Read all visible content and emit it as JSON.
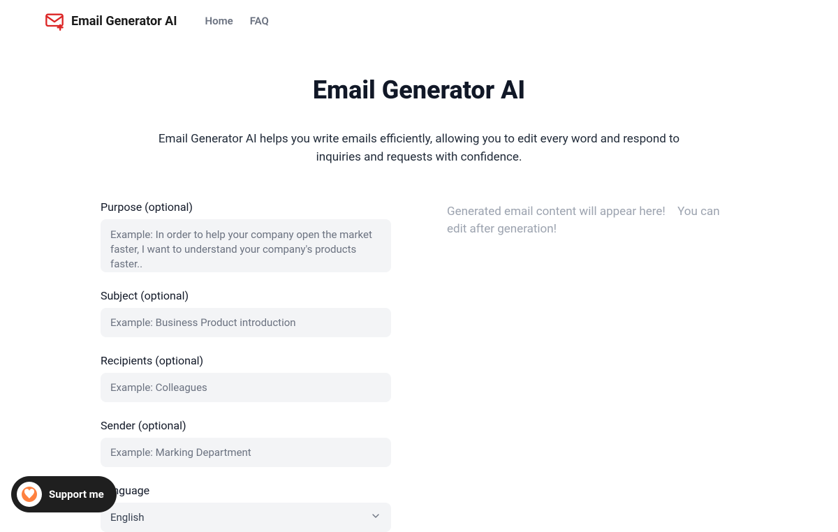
{
  "navbar": {
    "brand_text": "Email Generator AI",
    "links": [
      {
        "label": "Home"
      },
      {
        "label": "FAQ"
      }
    ]
  },
  "hero": {
    "title": "Email Generator AI",
    "description": "Email Generator AI helps you write emails efficiently, allowing you to edit every word and respond to inquiries and requests with confidence."
  },
  "form": {
    "purpose": {
      "label": "Purpose (optional)",
      "placeholder": "Example: In order to help your company open the market faster, I want to understand your company's products faster.."
    },
    "subject": {
      "label": "Subject (optional)",
      "placeholder": "Example: Business Product introduction"
    },
    "recipients": {
      "label": "Recipients (optional)",
      "placeholder": "Example: Colleagues"
    },
    "sender": {
      "label": "Sender (optional)",
      "placeholder": "Example: Marking Department"
    },
    "language": {
      "label": "Language",
      "selected": "English"
    }
  },
  "output": {
    "placeholder": "Generated email content will appear here! You can edit after generation!"
  },
  "support": {
    "label": "Support me"
  }
}
